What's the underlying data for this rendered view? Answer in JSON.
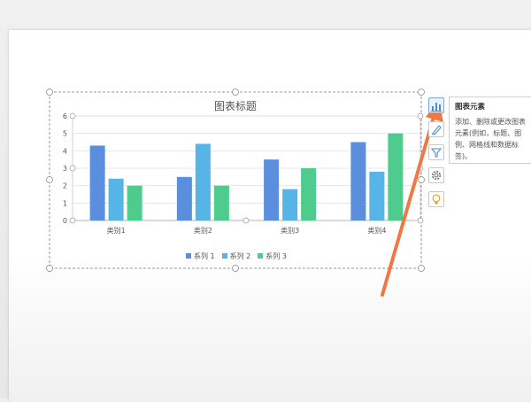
{
  "chart_data": {
    "type": "bar",
    "title": "图表标题",
    "categories": [
      "类别1",
      "类别2",
      "类别3",
      "类别4"
    ],
    "series": [
      {
        "name": "系列 1",
        "values": [
          4.3,
          2.5,
          3.5,
          4.5
        ],
        "color": "#5b8fde"
      },
      {
        "name": "系列 2",
        "values": [
          2.4,
          4.4,
          1.8,
          2.8
        ],
        "color": "#56b4e6"
      },
      {
        "name": "系列 3",
        "values": [
          2.0,
          2.0,
          3.0,
          5.0
        ],
        "color": "#4fcb8d"
      }
    ],
    "yticks": [
      "0",
      "1",
      "2",
      "3",
      "4",
      "5",
      "6"
    ],
    "ylim": [
      0,
      6
    ],
    "grid": true,
    "legend_position": "bottom"
  },
  "side_buttons": [
    {
      "icon": "chart-elements-icon",
      "active": true
    },
    {
      "icon": "chart-style-brush-icon"
    },
    {
      "icon": "chart-filter-icon"
    },
    {
      "icon": "settings-gear-icon"
    },
    {
      "icon": "lightbulb-icon"
    }
  ],
  "tooltip": {
    "title": "图表元素",
    "body": "添加、删除或更改图表元素(例如，标题、图例、网格线和数据标签)。"
  },
  "annotation_color": "#f07844"
}
